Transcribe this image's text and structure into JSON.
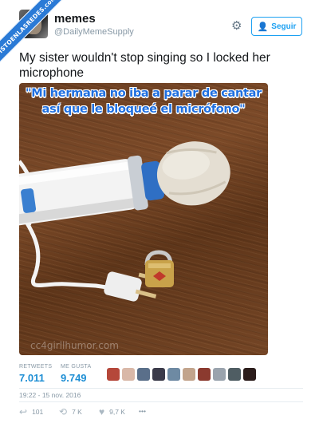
{
  "watermark_ribbon": "VISTOENLASREDES.com",
  "author": {
    "name": "memes",
    "handle": "@DailyMemeSupply"
  },
  "follow_button": {
    "label": "Seguir"
  },
  "tweet": {
    "text": "My sister wouldn't stop singing so I locked her microphone"
  },
  "image": {
    "caption_line1": "\"Mi hermana no iba a parar de cantar",
    "caption_line2": "así que le bloqueé el micrófono\"",
    "watermark": "cc4girllhumor.com"
  },
  "stats": {
    "retweets_label": "RETWEETS",
    "retweets_value": "7.011",
    "likes_label": "ME GUSTA",
    "likes_value": "9.749",
    "liker_colors": [
      "#b5473a",
      "#d9b8a8",
      "#5a6f8a",
      "#3b3b4a",
      "#6e8aa3",
      "#c2a48c",
      "#8b3a2f",
      "#9aa3ad",
      "#4f5d63",
      "#2b1d1b"
    ]
  },
  "timestamp": "19:22 - 15 nov. 2016",
  "actions": {
    "reply_count": "101",
    "retweet_count": "7 K",
    "like_count": "9,7 K",
    "more": "•••"
  },
  "colors": {
    "link_blue": "#1da1f2",
    "stat_blue": "#1d8ed4",
    "caption_blue": "#1f6fe0",
    "muted_gray": "#8899a6",
    "ribbon_blue": "#2a7ad6"
  }
}
